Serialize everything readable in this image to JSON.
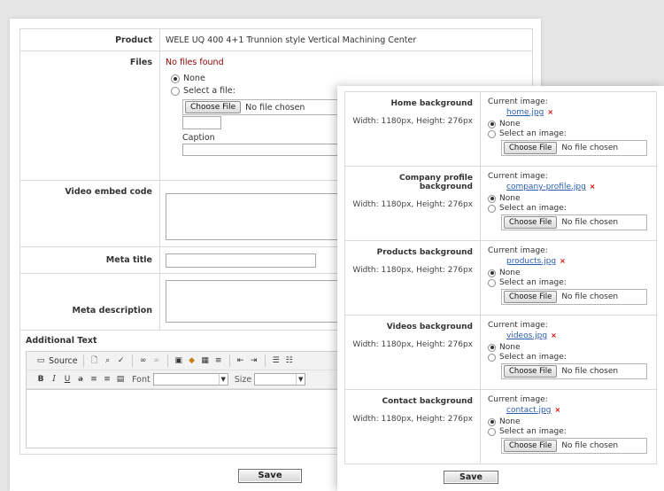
{
  "form": {
    "product_label": "Product",
    "product_value": "WELE UQ 400 4+1 Trunnion style Vertical Machining Center",
    "files_label": "Files",
    "files_status": "No files found",
    "radio_none": "None",
    "radio_select": "Select a file:",
    "choose_file": "Choose File",
    "no_file": "No file chosen",
    "caption_label": "Caption",
    "video_label": "Video embed code",
    "meta_title_label": "Meta title",
    "meta_desc_label": "Meta description",
    "additional_label": "Additional Text",
    "save": "Save"
  },
  "editor": {
    "source": "Source",
    "font": "Font",
    "size": "Size",
    "bold": "B",
    "italic": "I",
    "underline": "U"
  },
  "backgrounds": {
    "current_image": "Current image:",
    "none": "None",
    "select_image": "Select an image:",
    "choose_file": "Choose File",
    "no_file": "No file chosen",
    "remove_mark": "×",
    "save": "Save",
    "items": [
      {
        "title": "Home background",
        "dims": "Width: 1180px, Height: 276px",
        "file": "home.jpg"
      },
      {
        "title": "Company profile background",
        "dims": "Width: 1180px, Height: 276px",
        "file": "company-profile.jpg"
      },
      {
        "title": "Products background",
        "dims": "Width: 1180px, Height: 276px",
        "file": "products.jpg"
      },
      {
        "title": "Videos background",
        "dims": "Width: 1180px, Height: 276px",
        "file": "videos.jpg"
      },
      {
        "title": "Contact background",
        "dims": "Width: 1180px, Height: 276px",
        "file": "contact.jpg"
      }
    ]
  }
}
